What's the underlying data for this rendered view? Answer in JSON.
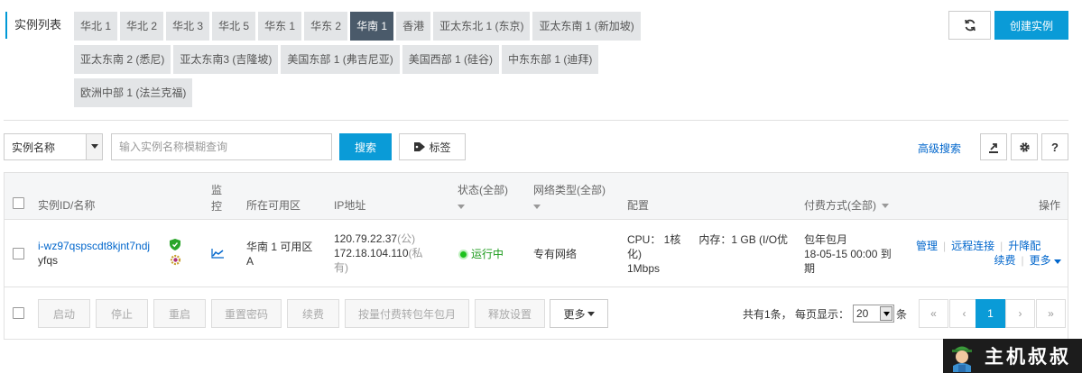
{
  "region": {
    "title": "实例列表",
    "tags": [
      {
        "label": "华北 1",
        "active": false
      },
      {
        "label": "华北 2",
        "active": false
      },
      {
        "label": "华北 3",
        "active": false
      },
      {
        "label": "华北 5",
        "active": false
      },
      {
        "label": "华东 1",
        "active": false
      },
      {
        "label": "华东 2",
        "active": false
      },
      {
        "label": "华南 1",
        "active": true
      },
      {
        "label": "香港",
        "active": false
      },
      {
        "label": "亚太东北 1 (东京)",
        "active": false
      },
      {
        "label": "亚太东南 1 (新加坡)",
        "active": false
      },
      {
        "label": "亚太东南 2 (悉尼)",
        "active": false
      },
      {
        "label": "亚太东南3 (吉隆坡)",
        "active": false
      },
      {
        "label": "美国东部 1 (弗吉尼亚)",
        "active": false
      },
      {
        "label": "美国西部 1 (硅谷)",
        "active": false
      },
      {
        "label": "中东东部 1 (迪拜)",
        "active": false
      },
      {
        "label": "欧洲中部 1 (法兰克福)",
        "active": false
      }
    ]
  },
  "toolbar": {
    "create_label": "创建实例",
    "refresh_icon": "refresh-icon"
  },
  "search": {
    "field_selected": "实例名称",
    "placeholder": "输入实例名称模糊查询",
    "search_label": "搜索",
    "tag_label": "标签",
    "advanced_label": "高级搜索"
  },
  "table": {
    "headers": {
      "id_name": "实例ID/名称",
      "monitor_line1": "监",
      "monitor_line2": "控",
      "zone": "所在可用区",
      "ip": "IP地址",
      "status": "状态(全部)",
      "network": "网络类型(全部)",
      "config": "配置",
      "billing": "付费方式(全部)",
      "actions": "操作"
    },
    "row": {
      "id": "i-wz97qspscdt8kjnt7ndj",
      "name": "yfqs",
      "zone_line1": "华南 1 可用区",
      "zone_line2": "A",
      "ip_public": "120.79.22.37",
      "ip_public_tag": "(公)",
      "ip_private": "172.18.104.110",
      "ip_private_tag": "(私",
      "ip_private_tag2": "有)",
      "status": "运行中",
      "network": "专有网络",
      "cpu": "CPU： 1核",
      "memory": "内存：1 GB (I/O优",
      "memory2": "化)",
      "bandwidth": "1Mbps",
      "billing_type": "包年包月",
      "billing_expire": "18-05-15 00:00 到",
      "billing_expire2": "期",
      "action_manage": "管理",
      "action_remote": "远程连接",
      "action_upgrade": "升降配",
      "action_renew": "续费",
      "action_more": "更多"
    }
  },
  "footer": {
    "buttons": [
      "启动",
      "停止",
      "重启",
      "重置密码",
      "续费",
      "按量付费转包年包月",
      "释放设置"
    ],
    "more_label": "更多",
    "total_text": "共有1条， 每页显示：",
    "page_size": "20",
    "page_unit": "条",
    "pages": [
      "«",
      "‹",
      "1",
      "›",
      "»"
    ],
    "current_page": "1"
  },
  "watermark": {
    "text": "主机叔叔"
  }
}
